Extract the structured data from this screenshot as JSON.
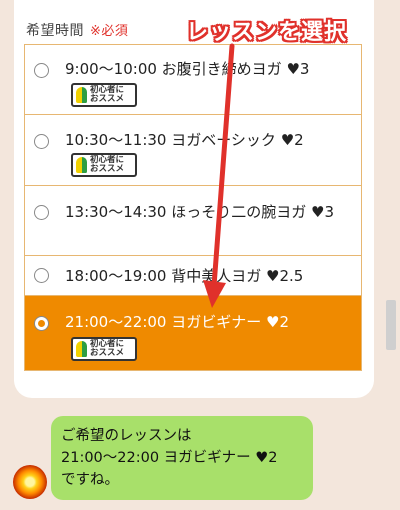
{
  "form": {
    "label": "希望時間",
    "required": "※必須",
    "options": [
      {
        "text": "9:00〜10:00 お腹引き締めヨガ ♥3",
        "badge": "初心者に\nおススメ",
        "selected": false
      },
      {
        "text": "10:30〜11:30 ヨガベーシック ♥2",
        "badge": "初心者に\nおススメ",
        "selected": false
      },
      {
        "text": "13:30〜14:30 ほっそり二の腕ヨガ ♥3",
        "selected": false
      },
      {
        "text": "18:00〜19:00 背中美人ヨガ ♥2.5",
        "selected": false
      },
      {
        "text": "21:00〜22:00 ヨガビギナー ♥2",
        "badge": "初心者に\nおススメ",
        "selected": true
      }
    ]
  },
  "annotation": {
    "text": "レッスンを選択",
    "color": "#e0312b"
  },
  "chat": {
    "message_lines": [
      "ご希望のレッスンは",
      "21:00〜22:00 ヨガビギナー ♥2",
      "ですね。"
    ],
    "bubble_color": "#a8e06a"
  },
  "colors": {
    "selected": "#ef8a00",
    "border": "#e7b772",
    "background": "#f3e6dc"
  }
}
